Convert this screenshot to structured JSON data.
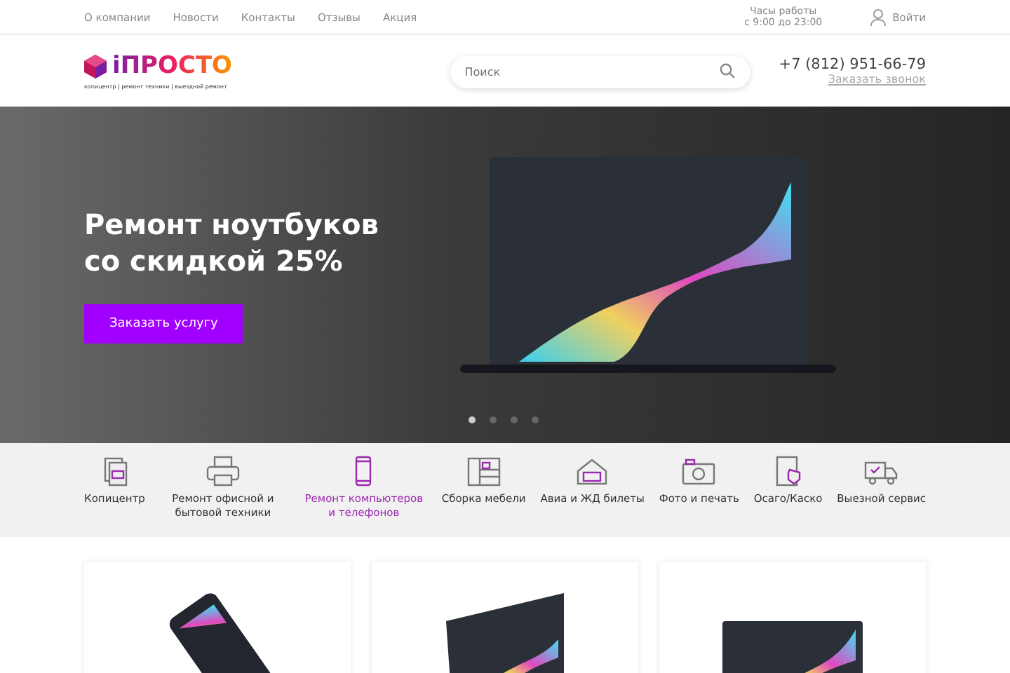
{
  "top_nav": [
    "О компании",
    "Новости",
    "Контакты",
    "Отзывы",
    "Акция"
  ],
  "hours": {
    "label": "Часы работы",
    "value": "с 9:00 до 23:00"
  },
  "login": "Войти",
  "logo": {
    "name": "iПРОСТО",
    "tagline": "копицентр | ремонт техники | выездной ремонт"
  },
  "search": {
    "placeholder": "Поиск"
  },
  "phone": "+7 (812) 951-66-79",
  "callback": "Заказать звонок",
  "hero": {
    "title": "Ремонт ноутбуков со скидкой 25%",
    "button": "Заказать услугу",
    "dots": [
      {
        "selected": true
      },
      {
        "selected": false
      },
      {
        "selected": false
      },
      {
        "selected": false
      }
    ]
  },
  "services": [
    {
      "kind": "copy",
      "label": "Копицентр",
      "selected": false
    },
    {
      "kind": "printer",
      "label": "Ремонт офисной и бытовой техники",
      "selected": false
    },
    {
      "kind": "phone",
      "label": "Ремонт компьютеров и телефонов",
      "selected": true
    },
    {
      "kind": "furniture",
      "label": "Сборка мебели",
      "selected": false
    },
    {
      "kind": "tickets",
      "label": "Авиа и ЖД билеты",
      "selected": false
    },
    {
      "kind": "camera",
      "label": "Фото и печать",
      "selected": false
    },
    {
      "kind": "insurance",
      "label": "Осаго/Каско",
      "selected": false
    },
    {
      "kind": "truck",
      "label": "Выезной сервис",
      "selected": false
    }
  ],
  "cards": [
    {
      "kind": "phone"
    },
    {
      "kind": "tablet"
    },
    {
      "kind": "laptop"
    }
  ]
}
